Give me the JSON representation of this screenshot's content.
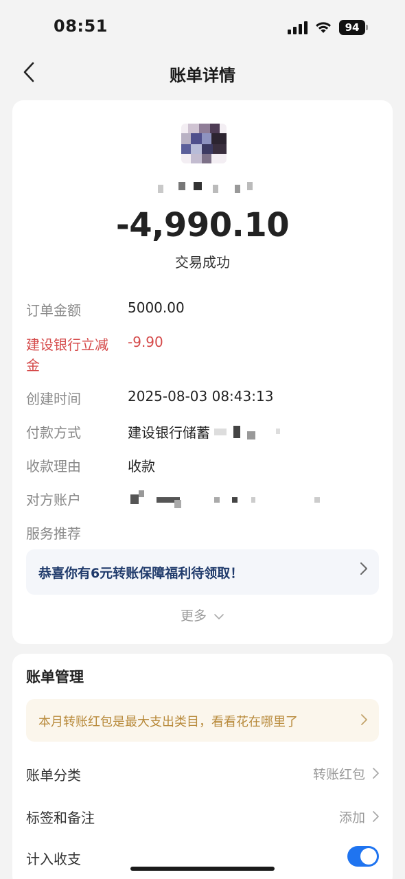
{
  "status_bar": {
    "time": "08:51",
    "battery": "94"
  },
  "nav": {
    "title": "账单详情",
    "back_icon": "chevron-left-icon"
  },
  "transaction": {
    "amount": "-4,990.10",
    "status": "交易成功"
  },
  "details": [
    {
      "label": "订单金额",
      "value": "5000.00"
    },
    {
      "label": "建设银行立减",
      "label2": "金",
      "value": "-9.90"
    },
    {
      "label": "创建时间",
      "value": "2025-08-03 08:43:13"
    },
    {
      "label": "付款方式",
      "value": "建设银行储蓄"
    },
    {
      "label": "收款理由",
      "value": "收款"
    },
    {
      "label": "对方账户",
      "value": ""
    },
    {
      "label": "服务推荐",
      "value": ""
    }
  ],
  "promo": {
    "text": "恭喜你有6元转账保障福利待领取！"
  },
  "more": {
    "label": "更多"
  },
  "management": {
    "title": "账单管理",
    "tip": "本月转账红包是最大支出类目，看看花在哪里了",
    "items": [
      {
        "label": "账单分类",
        "value": "转账红包"
      },
      {
        "label": "标签和备注",
        "value": "添加"
      },
      {
        "label": "计入收支",
        "value": ""
      }
    ],
    "include_in_stats": true
  },
  "colors": {
    "discount_red": "#d54a4a",
    "promo_text": "#1f3a6b",
    "tip_text": "#b88a3b",
    "toggle_on": "#1f74f0"
  }
}
